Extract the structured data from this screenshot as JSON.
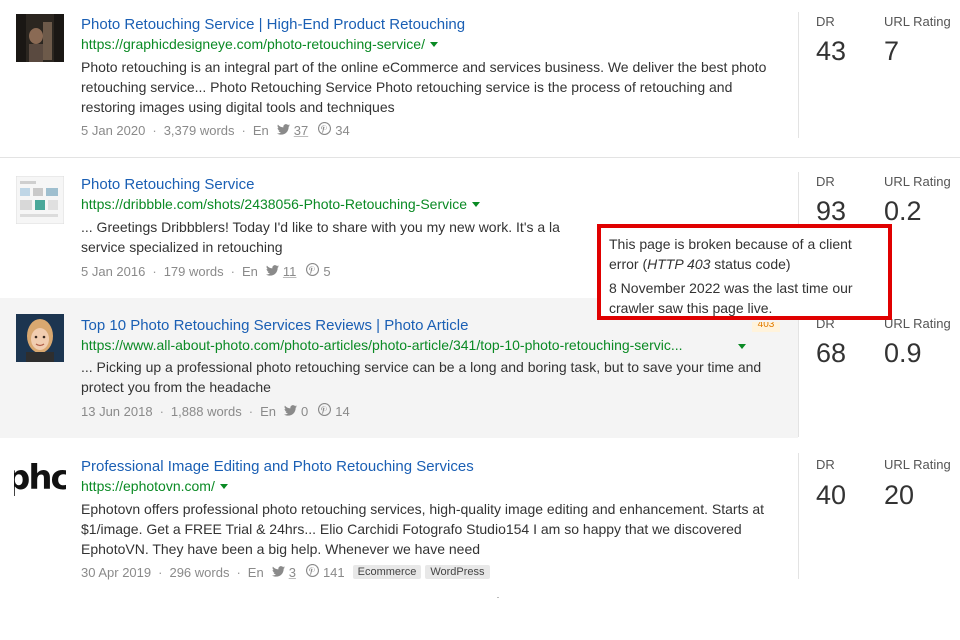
{
  "results": [
    {
      "title": "Photo Retouching Service | High-End Product Retouching",
      "url": "https://graphicdesigneye.com/photo-retouching-service/",
      "snippet": "Photo retouching is an integral part of the online eCommerce and services business. We deliver the best photo retouching service... Photo Retouching Service Photo retouching service is the process of retouching and restoring images using digital tools and techniques",
      "date": "5 Jan 2020",
      "words": "3,379 words",
      "lang": "En",
      "twitter": "37",
      "pinterest": "34",
      "dr_label": "DR",
      "dr": "43",
      "ur_label": "URL Rating",
      "ur": "7"
    },
    {
      "title": "Photo Retouching Service",
      "url": "https://dribbble.com/shots/2438056-Photo-Retouching-Service",
      "snippet_line1": "... Greetings Dribbblers! Today I'd like to share with you my new work. It's a la",
      "snippet_line2": "service specialized in retouching",
      "date": "5 Jan 2016",
      "words": "179 words",
      "lang": "En",
      "twitter": "11",
      "pinterest": "5",
      "dr_label": "DR",
      "dr": "93",
      "ur_label": "URL Rating",
      "ur": "0.2"
    },
    {
      "title": "Top 10 Photo Retouching Services Reviews | Photo Article",
      "url": "https://www.all-about-photo.com/photo-articles/photo-article/341/top-10-photo-retouching-servic...",
      "snippet": "... Picking up a professional photo retouching service can be a long and boring task, but to save your time and protect you from the headache",
      "date": "13 Jun 2018",
      "words": "1,888 words",
      "lang": "En",
      "twitter": "0",
      "pinterest": "14",
      "badge": "403",
      "dr_label": "DR",
      "dr": "68",
      "ur_label": "URL Rating",
      "ur": "0.9"
    },
    {
      "title": "Professional Image Editing and Photo Retouching Services",
      "url": "https://ephotovn.com/",
      "snippet": "Ephotovn offers professional photo retouching services, high-quality image editing and enhancement. Starts at $1/image. Get a FREE Trial & 24hrs... Elio Carchidi Fotografo Studio154 I am so happy that we discovered EphotoVN. They have been a big help. Whenever we have need",
      "date": "30 Apr 2019",
      "words": "296 words",
      "lang": "En",
      "twitter": "3",
      "pinterest": "141",
      "tags": [
        "Ecommerce",
        "WordPress"
      ],
      "logo_text": "phc",
      "dr_label": "DR",
      "dr": "40",
      "ur_label": "URL Rating",
      "ur": "20"
    }
  ],
  "tooltip": {
    "line1_prefix": "This page is broken because of a client error (",
    "code": "HTTP 403",
    "line1_suffix": " status code)",
    "line2": "8 November 2022 was the last time our crawler saw this page live."
  },
  "colors": {
    "title_link": "#1a5fb4",
    "url_green": "#0a8a24",
    "highlight_border": "#e00000"
  }
}
